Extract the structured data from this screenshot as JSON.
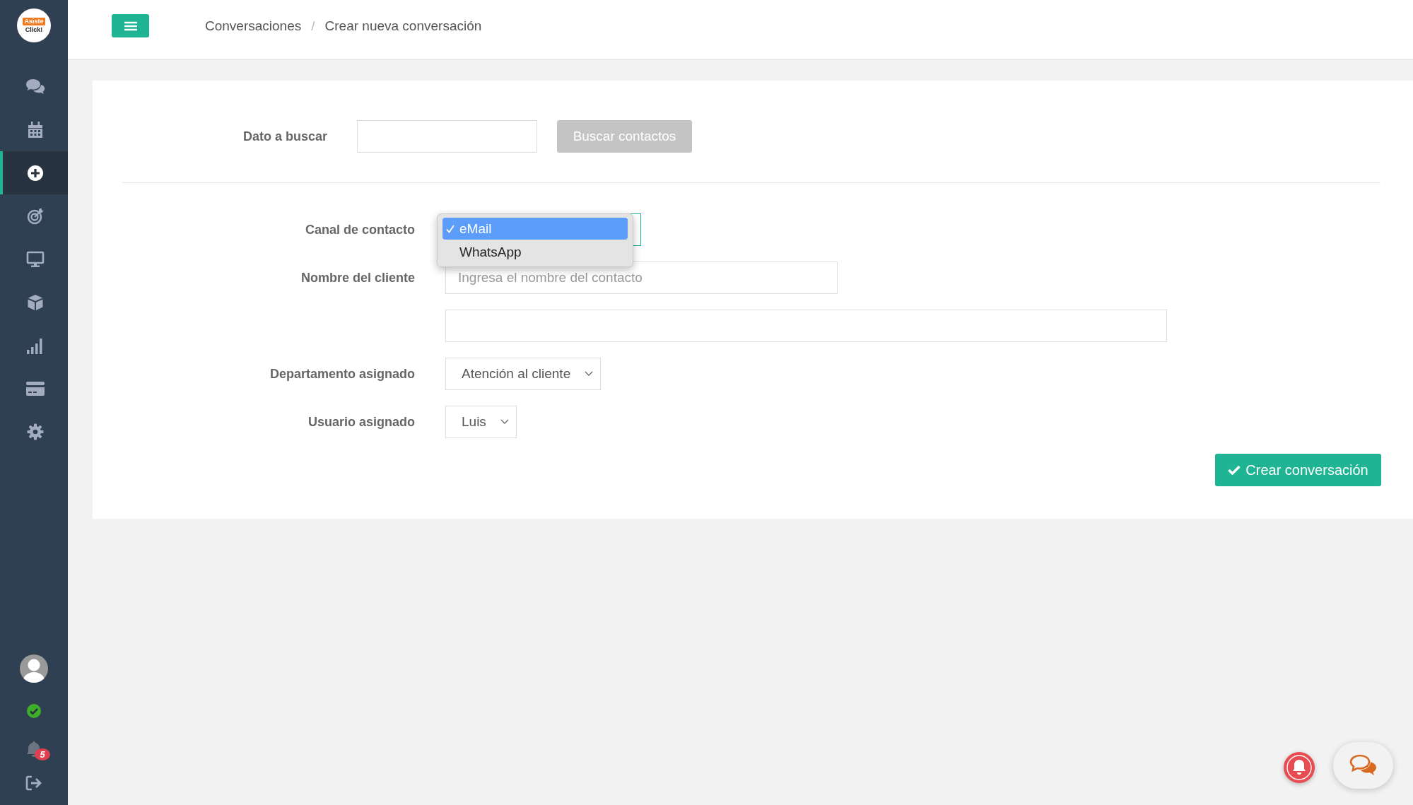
{
  "sidebar": {
    "logo": {
      "line_1": "Asiste",
      "line_2": "Click!"
    },
    "nav_items": [
      {
        "kind": "chat",
        "selected": false
      },
      {
        "kind": "calendar",
        "selected": false
      },
      {
        "kind": "plus",
        "selected": true
      },
      {
        "kind": "target",
        "selected": false
      },
      {
        "kind": "monitor",
        "selected": false
      },
      {
        "kind": "box",
        "selected": false
      },
      {
        "kind": "signal",
        "selected": false
      },
      {
        "kind": "card",
        "selected": false
      },
      {
        "kind": "gear",
        "selected": false
      }
    ],
    "user_status": {
      "online": true
    },
    "notifications": {
      "count": "5"
    }
  },
  "topbar": {
    "breadcrumb": {
      "items": [
        "Conversaciones",
        "Crear nueva conversación"
      ],
      "separator": "/"
    }
  },
  "search": {
    "label": "Dato a buscar",
    "button": {
      "label": "Buscar contactos",
      "disabled": true
    }
  },
  "form": {
    "rows": [
      {
        "kind": "select",
        "label": "Canal de contacto",
        "open": true,
        "options": [
          {
            "label": "eMail",
            "selected": true
          },
          {
            "label": "WhatsApp",
            "selected": false
          }
        ]
      },
      {
        "kind": "text",
        "label": "Nombre del cliente",
        "placeholder": "Ingresa el nombre del contacto"
      },
      {
        "kind": "text"
      },
      {
        "kind": "select",
        "label": "Departamento asignado",
        "value": "Atención al cliente"
      },
      {
        "kind": "select",
        "label": "Usuario asignado",
        "value": "Luis"
      }
    ],
    "submit": "Crear conversación"
  }
}
